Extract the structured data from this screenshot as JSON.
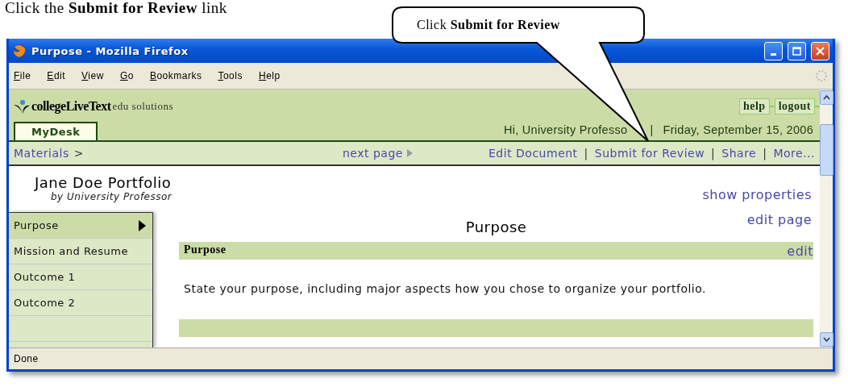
{
  "caption": "Click the **Submit for Review** link",
  "callout": {
    "text": "Click **Submit for Review**"
  },
  "window": {
    "title": "Purpose - Mozilla Firefox"
  },
  "menu": [
    "File",
    "Edit",
    "View",
    "Go",
    "Bookmarks",
    "Tools",
    "Help"
  ],
  "site": {
    "logo": "collegeLiveText",
    "logo_suffix": "edu solutions",
    "links": [
      "help",
      "logout"
    ],
    "tabs": [
      {
        "label": "MyDesk",
        "selected": true
      }
    ],
    "greeting": "Hi, University Professo",
    "separator": "|",
    "date": "Friday, September 15, 2006"
  },
  "nav": {
    "breadcrumb": "Materials",
    "breadcrumb_sep": ">",
    "next": "next page",
    "actions": [
      {
        "kind": "link",
        "text": "Edit Document"
      },
      {
        "kind": "separator",
        "text": "|"
      },
      {
        "kind": "link",
        "text": "Submit for Review"
      },
      {
        "kind": "separator",
        "text": "|"
      },
      {
        "kind": "link",
        "text": "Share"
      },
      {
        "kind": "separator",
        "text": "|"
      },
      {
        "kind": "link",
        "text": "More..."
      }
    ]
  },
  "doc": {
    "title": "Jane Doe Portfolio",
    "author": "by University Professor",
    "show_properties": "show properties",
    "edit_page": "edit page",
    "page_title": "Purpose"
  },
  "sidebar": [
    {
      "label": "Purpose",
      "selected": true
    },
    {
      "label": "Mission and Resume",
      "selected": false
    },
    {
      "label": "Outcome 1",
      "selected": false
    },
    {
      "label": "Outcome 2",
      "selected": false
    }
  ],
  "sections": [
    {
      "title": "Purpose",
      "edit": "edit",
      "body": "State your purpose, including major aspects how you chose to organize your portfolio."
    }
  ],
  "status": "Done"
}
